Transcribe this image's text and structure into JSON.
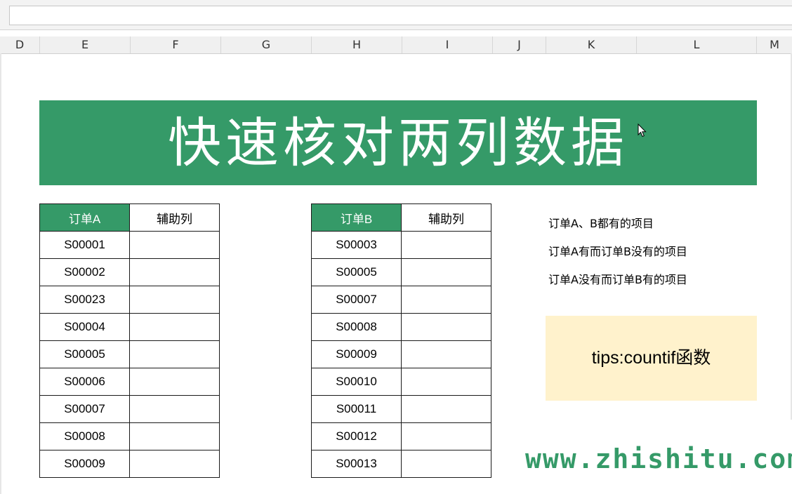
{
  "column_headers": [
    "D",
    "E",
    "F",
    "G",
    "H",
    "I",
    "J",
    "K",
    "L",
    "M"
  ],
  "banner": {
    "title": "快速核对两列数据"
  },
  "table_a": {
    "headers": [
      "订单A",
      "辅助列"
    ],
    "rows": [
      "S00001",
      "S00002",
      "S00023",
      "S00004",
      "S00005",
      "S00006",
      "S00007",
      "S00008",
      "S00009"
    ]
  },
  "table_b": {
    "headers": [
      "订单B",
      "辅助列"
    ],
    "rows": [
      "S00003",
      "S00005",
      "S00007",
      "S00008",
      "S00009",
      "S00010",
      "S00011",
      "S00012",
      "S00013"
    ]
  },
  "labels": [
    "订单A、B都有的项目",
    "订单A有而订单B没有的项目",
    "订单A没有而订单B有的项目"
  ],
  "tips": "tips:countif函数",
  "watermark": "www.zhishitu.com",
  "colors": {
    "accent": "#359a68",
    "tips_bg": "#fff2cc"
  }
}
